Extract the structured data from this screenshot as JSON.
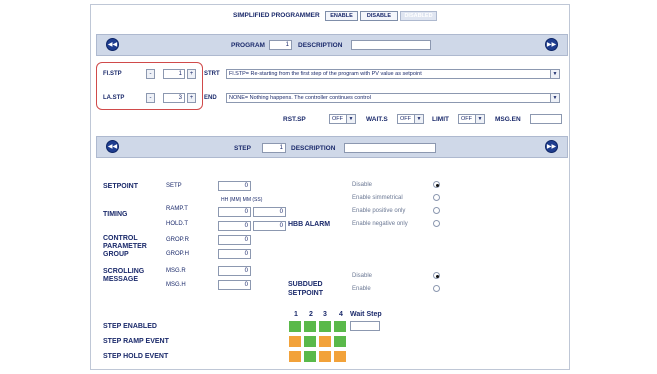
{
  "top": {
    "title": "SIMPLIFIED PROGRAMMER",
    "enable": "ENABLE",
    "disable": "DISABLE",
    "disabled_btn": "DISABLED"
  },
  "program_bar": {
    "prev": "◀◀",
    "next": "▶▶",
    "program_label": "PROGRAM",
    "program_value": "1",
    "description_label": "DESCRIPTION",
    "description_value": ""
  },
  "fields": {
    "fl_stp_label": "Fl.STP",
    "fl_stp_value": "1",
    "la_stp_label": "LA.STP",
    "la_stp_value": "3",
    "minus": "-",
    "plus": "+",
    "strt_label": "STRT",
    "strt_value": "Fl.STP= Re-starting from the first step of the program with PV value as setpoint",
    "end_label": "END",
    "end_value": "NONE= Nothing happens. The controller continues control",
    "rst_label": "RST.SP",
    "rst_value": "OFF",
    "wait_label": "WAIT.S",
    "wait_value": "OFF",
    "limit_label": "LIMIT",
    "limit_value": "OFF",
    "msg_label": "MSG.EN",
    "msg_value": ""
  },
  "step_bar": {
    "prev": "◀◀",
    "next": "▶▶",
    "step_label": "STEP",
    "step_value": "1",
    "description_label": "DESCRIPTION",
    "description_value": ""
  },
  "step": {
    "setpoint_label": "SETPOINT",
    "setp_label": "SETP",
    "setp_value": "0",
    "timing_header": "HH (MM) MM (SS)",
    "timing_label": "TIMING",
    "ramp_label": "RAMP.T",
    "ramp_a": "0",
    "ramp_b": "0",
    "hold_label": "HOLD.T",
    "hold_a": "0",
    "hold_b": "0",
    "control_label": "CONTROL PARAMETER GROUP",
    "grop_r_label": "GROP.R",
    "grop_r_value": "0",
    "grop_h_label": "GROP.H",
    "grop_h_value": "0",
    "scroll_label": "SCROLLING MESSAGE",
    "msg_r_label": "MSG.R",
    "msg_r_value": "0",
    "msg_h_label": "MSG.H",
    "msg_h_value": "0"
  },
  "hbb": {
    "label": "HBB ALARM",
    "options": [
      "Disable",
      "Enable simmetrical",
      "Enable positive only",
      "Enable negative only"
    ],
    "selected": 0
  },
  "subdued": {
    "label": "SUBDUED SETPOINT",
    "options": [
      "Disable",
      "Enable"
    ],
    "selected": 0
  },
  "events": {
    "cols": [
      "1",
      "2",
      "3",
      "4"
    ],
    "wait_step": "Wait Step",
    "rows": [
      "STEP ENABLED",
      "STEP RAMP EVENT",
      "STEP HOLD EVENT"
    ],
    "colors": {
      "green": "#5ab94a",
      "orange": "#f2a23a"
    }
  }
}
